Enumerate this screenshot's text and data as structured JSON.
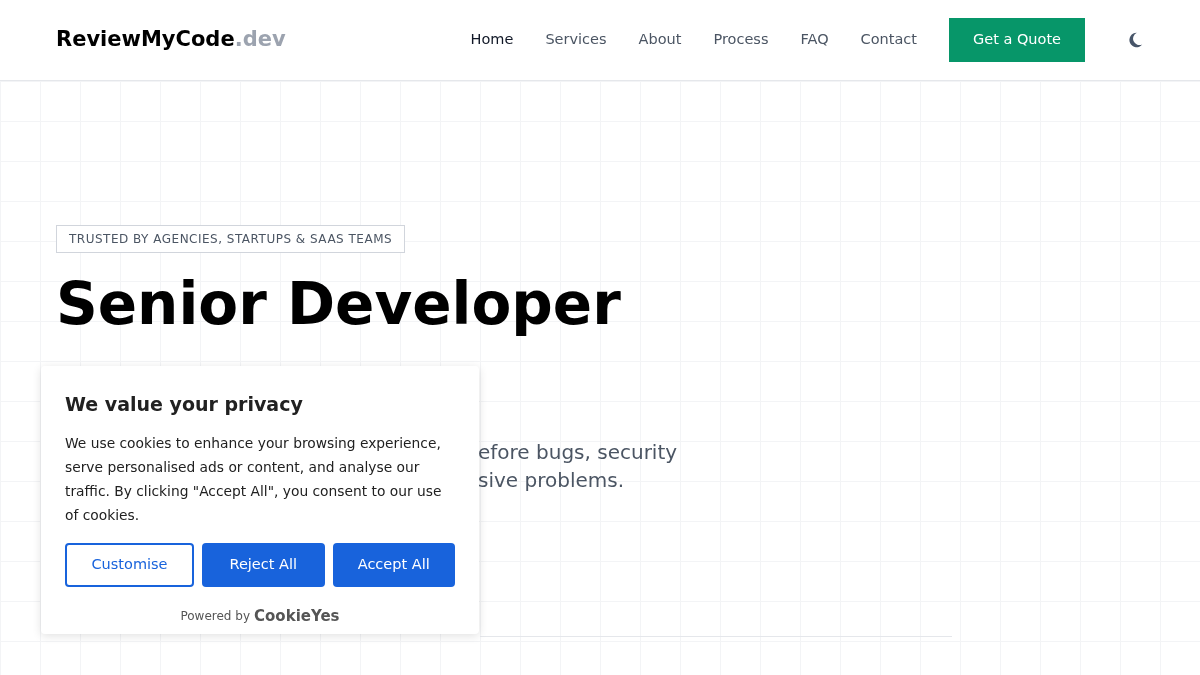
{
  "header": {
    "logo": {
      "name": "ReviewMyCode",
      "suffix": ".dev"
    },
    "nav": [
      {
        "label": "Home",
        "selected": true
      },
      {
        "label": "Services",
        "selected": false
      },
      {
        "label": "About",
        "selected": false
      },
      {
        "label": "Process",
        "selected": false
      },
      {
        "label": "FAQ",
        "selected": false
      },
      {
        "label": "Contact",
        "selected": false
      }
    ],
    "cta": "Get a Quote"
  },
  "hero": {
    "badge": "TRUSTED BY AGENCIES, STARTUPS & SAAS TEAMS",
    "heading_lines": [
      "Senior Developer"
    ],
    "subtitle_lines": [
      "efore bugs, security",
      "sive problems."
    ]
  },
  "cookie_banner": {
    "title": "We value your privacy",
    "text": "We use cookies to enhance your browsing experience, serve personalised ads or content, and analyse our traffic. By clicking \"Accept All\", you consent to our use of cookies.",
    "buttons": [
      {
        "label": "Customise",
        "kind": "outline"
      },
      {
        "label": "Reject All",
        "kind": "solid"
      },
      {
        "label": "Accept All",
        "kind": "solid"
      }
    ],
    "powered_by": "Powered by",
    "brand": "CookieYes"
  }
}
